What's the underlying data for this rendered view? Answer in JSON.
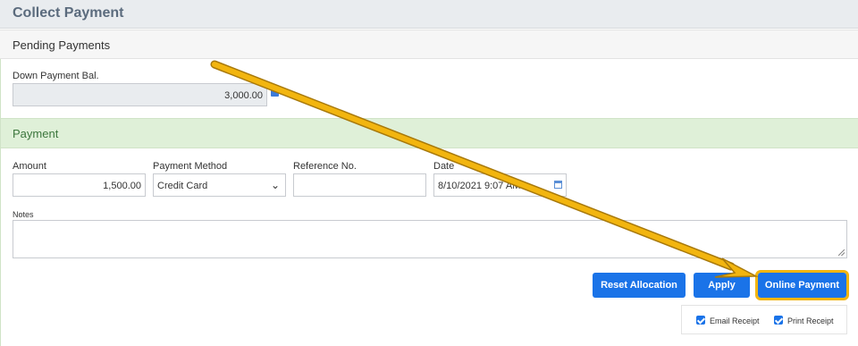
{
  "header": {
    "title": "Collect Payment"
  },
  "pending": {
    "section_title": "Pending Payments",
    "down_payment_label": "Down Payment Bal.",
    "down_payment_value": "3,000.00"
  },
  "payment": {
    "section_title": "Payment",
    "amount_label": "Amount",
    "amount_value": "1,500.00",
    "method_label": "Payment Method",
    "method_value": "Credit Card",
    "reference_label": "Reference No.",
    "reference_value": "",
    "date_label": "Date",
    "date_value": "8/10/2021 9:07 AM",
    "notes_label": "Notes",
    "notes_value": ""
  },
  "actions": {
    "reset_label": "Reset Allocation",
    "apply_label": "Apply",
    "online_label": "Online Payment"
  },
  "receipts": {
    "email_label": "Email Receipt",
    "email_checked": true,
    "print_label": "Print Receipt",
    "print_checked": true
  },
  "icons": {
    "calculator": "calculator-icon",
    "select": "chevron-down-icon",
    "date": "calendar-icon"
  },
  "colors": {
    "primary": "#1a73e8",
    "highlight": "#f2b50f",
    "payment_section_bg": "#dff0d8",
    "title_text": "#5b6b7d"
  }
}
